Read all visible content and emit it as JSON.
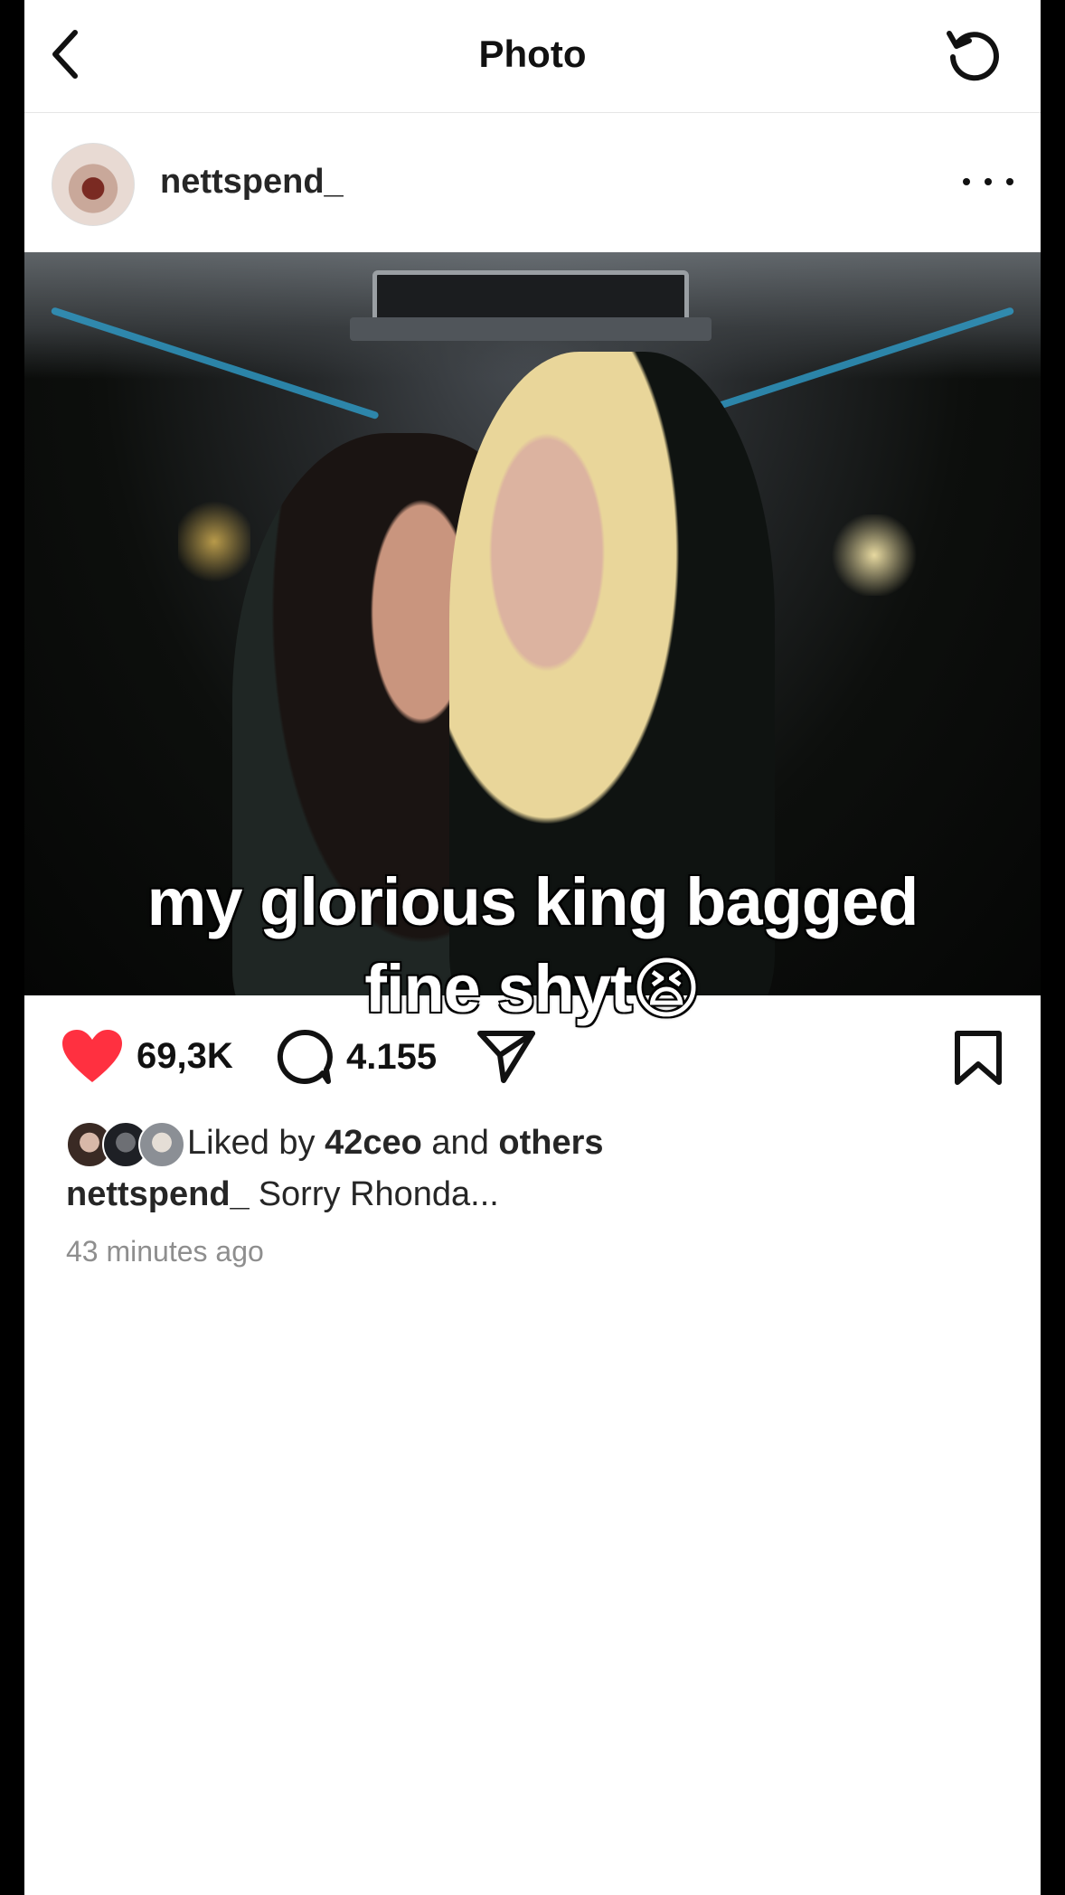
{
  "header": {
    "title": "Photo",
    "back_icon": "chevron-left-icon",
    "refresh_icon": "refresh-icon"
  },
  "post": {
    "username": "nettspend_",
    "more_icon": "more-horizontal-icon",
    "caption_overlay_line1": "my glorious king bagged",
    "caption_overlay_line2": "fine shyt😫",
    "likes_count": "69,3K",
    "comments_count": "4.155",
    "liked_by_prefix": "Liked by",
    "liked_by_user": "42ceo",
    "liked_by_and": "and",
    "liked_by_others": "others",
    "caption_user": "nettspend_",
    "caption_text": "Sorry Rhonda...",
    "time_ago": "43 minutes ago"
  },
  "colors": {
    "like_red": "#ff3040",
    "text_dark": "#262626",
    "text_muted": "#8e8e8e"
  }
}
